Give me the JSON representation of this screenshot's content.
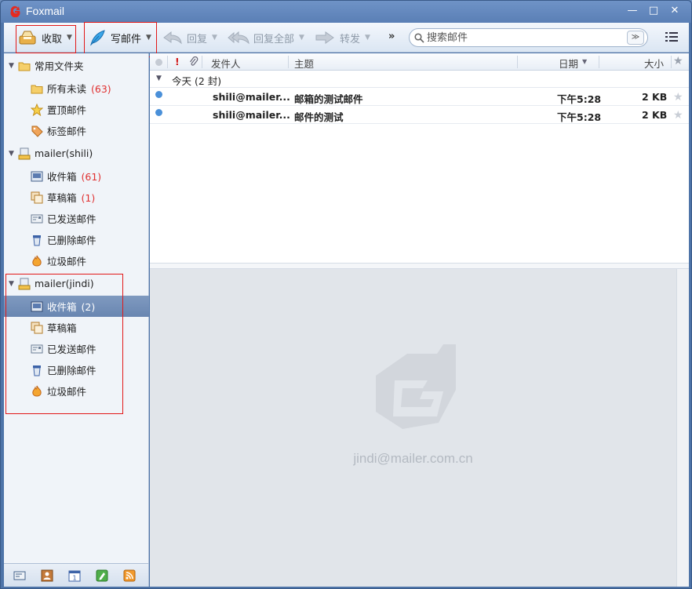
{
  "app": {
    "title": "Foxmail"
  },
  "window_controls": {
    "minimize": "—",
    "maximize": "□",
    "close": "✕"
  },
  "toolbar": {
    "receive": "收取",
    "compose": "写邮件",
    "reply": "回复",
    "reply_all": "回复全部",
    "forward": "转发",
    "more": "»",
    "search_placeholder": "搜索邮件"
  },
  "sidebar": {
    "favorites": {
      "label": "常用文件夹",
      "items": [
        {
          "label": "所有未读",
          "count": "(63)"
        },
        {
          "label": "置顶邮件",
          "count": ""
        },
        {
          "label": "标签邮件",
          "count": ""
        }
      ]
    },
    "accounts": [
      {
        "label": "mailer(shili)",
        "items": [
          {
            "label": "收件箱",
            "count": "(61)"
          },
          {
            "label": "草稿箱",
            "count": "(1)"
          },
          {
            "label": "已发送邮件",
            "count": ""
          },
          {
            "label": "已删除邮件",
            "count": ""
          },
          {
            "label": "垃圾邮件",
            "count": ""
          }
        ]
      },
      {
        "label": "mailer(jindi)",
        "items": [
          {
            "label": "收件箱",
            "count": "(2)"
          },
          {
            "label": "草稿箱",
            "count": ""
          },
          {
            "label": "已发送邮件",
            "count": ""
          },
          {
            "label": "已删除邮件",
            "count": ""
          },
          {
            "label": "垃圾邮件",
            "count": ""
          }
        ]
      }
    ]
  },
  "list": {
    "columns": {
      "flag": "!",
      "sender": "发件人",
      "subject": "主题",
      "date": "日期",
      "size": "大小"
    },
    "group": "今天 (2 封)",
    "messages": [
      {
        "sender": "shili@mailer...",
        "subject": "邮箱的测试邮件",
        "date": "下午5:28",
        "size": "2 KB"
      },
      {
        "sender": "shili@mailer...",
        "subject": "邮件的测试",
        "date": "下午5:28",
        "size": "2 KB"
      }
    ]
  },
  "preview": {
    "account": "jindi@mailer.com.cn"
  },
  "colors": {
    "accent": "#6986b1",
    "highlight": "#e21818",
    "unread": "#4a90d9",
    "count": "#e03030"
  }
}
